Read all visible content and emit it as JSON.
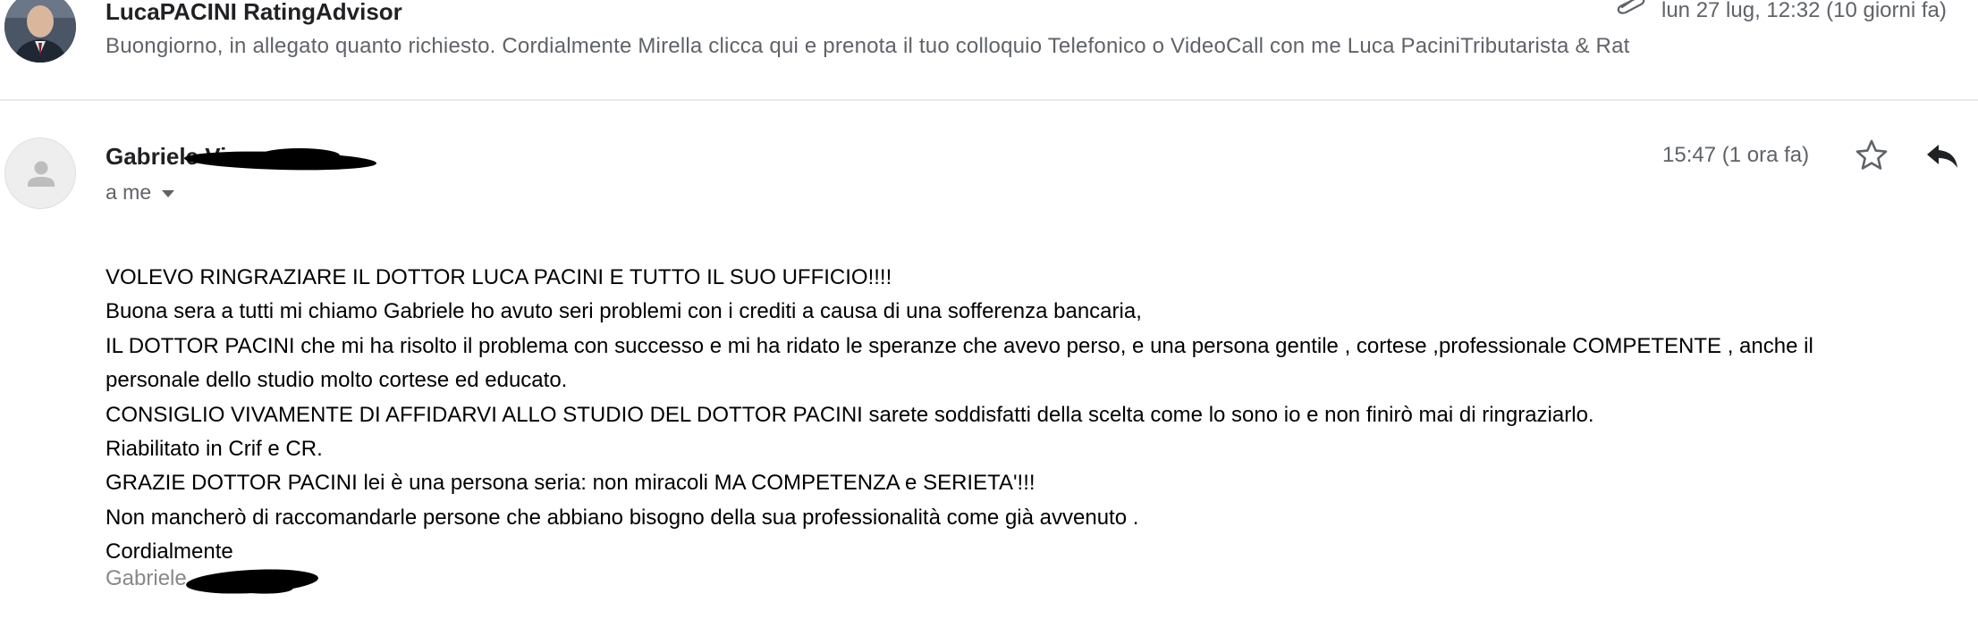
{
  "previous_message": {
    "sender": "LucaPACINI RatingAdvisor",
    "date": "lun 27 lug, 12:32 (10 giorni fa)",
    "snippet": "Buongiorno, in allegato quanto richiesto. Cordialmente Mirella clicca qui e prenota il tuo colloquio Telefonico o VideoCall con me Luca PaciniTributarista & Rat",
    "has_attachment_icon": "paperclip-icon"
  },
  "open_message": {
    "sender": "Gabriele Vi",
    "recipient": "a me",
    "time": "15:47 (1 ora fa)",
    "body": [
      "VOLEVO RINGRAZIARE IL DOTTOR LUCA PACINI E TUTTO IL SUO UFFICIO!!!!",
      "Buona sera a tutti mi chiamo Gabriele  ho avuto seri problemi con i crediti a causa di una sofferenza bancaria,",
      "IL  DOTTOR PACINI che mi ha risolto il problema con successo e mi ha ridato le speranze che avevo perso, e una persona gentile , cortese ,professionale COMPETENTE , anche il",
      "personale dello studio molto cortese ed educato.",
      "CONSIGLIO VIVAMENTE DI AFFIDARVI ALLO STUDIO DEL DOTTOR PACINI sarete soddisfatti della scelta come lo sono io e non finirò mai di ringraziarlo.",
      "Riabilitato in Crif e CR.",
      "GRAZIE DOTTOR PACINI lei è una persona seria:  non miracoli MA COMPETENZA e SERIETA'!!!",
      "Non mancherò di raccomandarle persone che abbiano bisogno della sua professionalità come già avvenuto .",
      "Cordialmente"
    ],
    "signature": "Gabriele"
  },
  "icons": {
    "star": "star-outline-icon",
    "reply": "reply-icon",
    "avatar": "person-icon"
  },
  "colors": {
    "secondary_text": "#5f6368",
    "primary_text": "#202124",
    "divider": "#e8eaed",
    "redaction": "#000000"
  }
}
